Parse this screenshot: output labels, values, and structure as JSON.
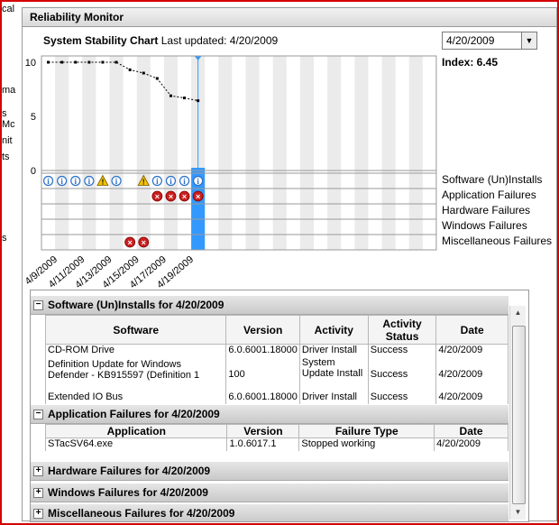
{
  "left_pane": {
    "fragments": [
      "cal",
      "ma",
      "s",
      "Mc",
      "nit",
      "ts",
      "s"
    ]
  },
  "window": {
    "title": "Reliability Monitor"
  },
  "chart_header": {
    "title": "System Stability Chart",
    "last_updated_label": "Last updated: 4/20/2009"
  },
  "date_select": {
    "value": "4/20/2009",
    "arrow": "▼"
  },
  "index": {
    "label": "Index: 6.45"
  },
  "chart_data": {
    "type": "line",
    "title": "System Stability Chart",
    "x": [
      "4/9/2009",
      "4/10/2009",
      "4/11/2009",
      "4/12/2009",
      "4/13/2009",
      "4/14/2009",
      "4/15/2009",
      "4/16/2009",
      "4/17/2009",
      "4/18/2009",
      "4/19/2009",
      "4/20/2009"
    ],
    "x_tick_labels": [
      "4/9/2009",
      "4/11/2009",
      "4/13/2009",
      "4/15/2009",
      "4/17/2009",
      "4/19/2009"
    ],
    "series": [
      {
        "values": [
          10,
          10,
          10,
          10,
          10,
          10,
          9.3,
          9.0,
          8.5,
          6.9,
          6.7,
          6.45
        ]
      }
    ],
    "y_ticks": [
      "10",
      "5",
      "0"
    ],
    "ylim": [
      0,
      10
    ],
    "selected_date": "4/20/2009",
    "categories": [
      "Software (Un)Installs",
      "Application Failures",
      "Hardware Failures",
      "Windows Failures",
      "Miscellaneous Failures"
    ],
    "events": [
      {
        "row": 0,
        "day": 0,
        "kind": "info"
      },
      {
        "row": 0,
        "day": 1,
        "kind": "info"
      },
      {
        "row": 0,
        "day": 2,
        "kind": "info"
      },
      {
        "row": 0,
        "day": 3,
        "kind": "info"
      },
      {
        "row": 0,
        "day": 4,
        "kind": "warning"
      },
      {
        "row": 0,
        "day": 5,
        "kind": "info"
      },
      {
        "row": 0,
        "day": 7,
        "kind": "warning"
      },
      {
        "row": 0,
        "day": 8,
        "kind": "info"
      },
      {
        "row": 0,
        "day": 9,
        "kind": "info"
      },
      {
        "row": 0,
        "day": 10,
        "kind": "info"
      },
      {
        "row": 0,
        "day": 11,
        "kind": "info"
      },
      {
        "row": 1,
        "day": 8,
        "kind": "error"
      },
      {
        "row": 1,
        "day": 9,
        "kind": "error"
      },
      {
        "row": 1,
        "day": 10,
        "kind": "error"
      },
      {
        "row": 1,
        "day": 11,
        "kind": "error"
      },
      {
        "row": 4,
        "day": 6,
        "kind": "error"
      },
      {
        "row": 4,
        "day": 7,
        "kind": "error"
      }
    ]
  },
  "sections": {
    "software": {
      "title": "Software (Un)Installs for 4/20/2009",
      "columns": [
        "Software",
        "Version",
        "Activity",
        "Activity Status",
        "Date"
      ],
      "rows": [
        [
          "CD-ROM Drive",
          "6.0.6001.18000",
          "Driver Install",
          "Success",
          "4/20/2009"
        ],
        [
          "Definition Update for Windows Defender - KB915597 (Definition 1",
          "100",
          "System Update Install",
          "Success",
          "4/20/2009"
        ],
        [
          "Extended IO Bus",
          "6.0.6001.18000",
          "Driver Install",
          "Success",
          "4/20/2009"
        ]
      ]
    },
    "app_failures": {
      "title": "Application Failures for 4/20/2009",
      "columns": [
        "Application",
        "Version",
        "Failure Type",
        "Date"
      ],
      "rows": [
        [
          "STacSV64.exe",
          "1.0.6017.1",
          "Stopped working",
          "4/20/2009"
        ]
      ]
    },
    "hardware": {
      "title": "Hardware Failures for 4/20/2009"
    },
    "windows": {
      "title": "Windows Failures for 4/20/2009"
    },
    "misc": {
      "title": "Miscellaneous Failures for 4/20/2009"
    }
  },
  "colors": {
    "selection": "#3399ff",
    "stripe": "#ebebeb",
    "error": "#cc1f1f",
    "warning": "#f2c200",
    "info": "#2a6fc9"
  }
}
